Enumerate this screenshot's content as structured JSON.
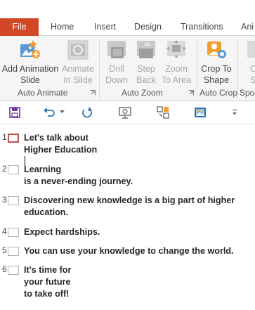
{
  "tabs": {
    "file": "File",
    "home": "Home",
    "insert": "Insert",
    "design": "Design",
    "transitions": "Transitions",
    "animations": "Ani"
  },
  "ribbon": {
    "add_animation": [
      "Add Animation",
      "Slide"
    ],
    "animate_in_slide": [
      "Animate",
      "In Slide"
    ],
    "drill_down": [
      "Drill",
      "Down"
    ],
    "step_back": [
      "Step",
      "Back"
    ],
    "zoom_to_area": [
      "Zoom",
      "To Area"
    ],
    "crop_to_shape": [
      "Crop To",
      "Shape"
    ],
    "partial_button": [
      "C",
      "S"
    ],
    "groups": {
      "auto_animate": "Auto Animate",
      "auto_zoom": "Auto Zoom",
      "auto_crop": "Auto Crop",
      "spot": "Spo"
    }
  },
  "qat": {
    "icons": [
      "save-icon",
      "undo-icon",
      "redo-icon",
      "slideshow-icon",
      "compare-icon",
      "picture-icon",
      "customize-icon"
    ]
  },
  "outline": [
    {
      "num": "1",
      "lines": [
        "Let's talk about",
        "Higher Education"
      ],
      "selected": true
    },
    {
      "num": "2",
      "lines": [
        "Learning",
        "is a never-ending journey."
      ],
      "selected": false
    },
    {
      "num": "3",
      "lines": [
        "Discovering new knowledge is a big part of higher",
        "education."
      ],
      "selected": false
    },
    {
      "num": "4",
      "lines": [
        "Expect hardships."
      ],
      "selected": false
    },
    {
      "num": "5",
      "lines": [
        "You can use your knowledge to change the world."
      ],
      "selected": false
    },
    {
      "num": "6",
      "lines": [
        "It's time for",
        "your future",
        "to take off!"
      ],
      "selected": false
    }
  ],
  "colors": {
    "file_tab": "#d24726",
    "accent_red": "#c0504d",
    "disabled": "#a6a6a6"
  }
}
